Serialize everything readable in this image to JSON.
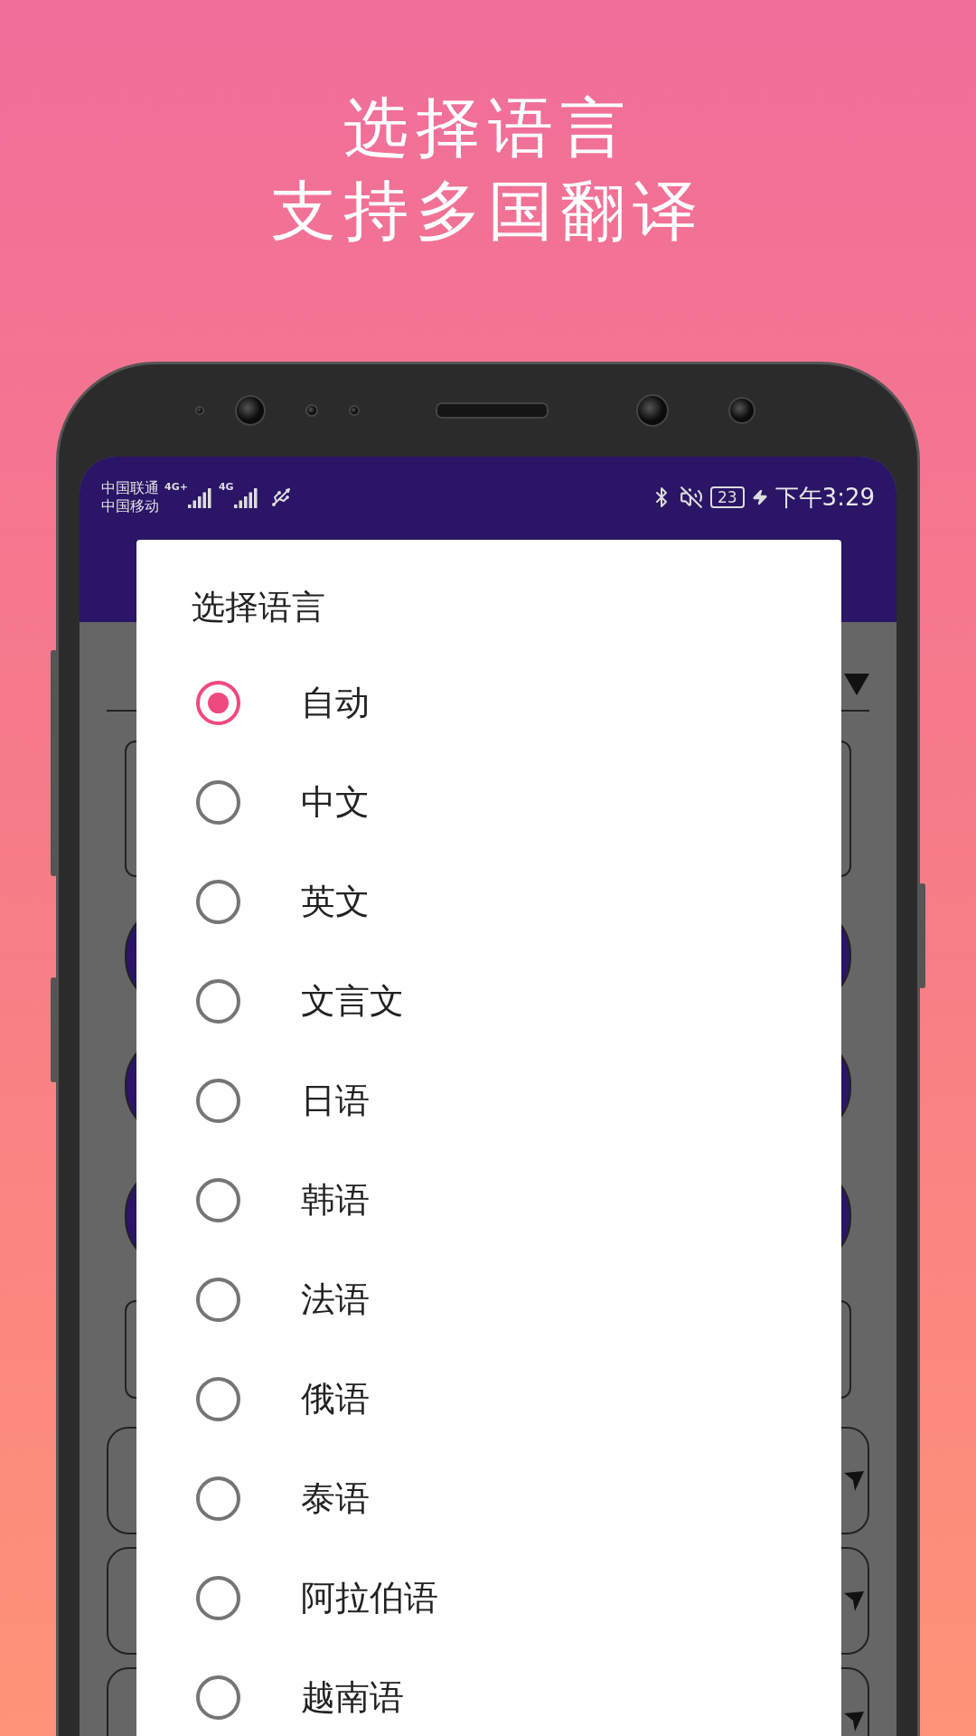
{
  "headline": [
    "选择语言",
    "支持多国翻译"
  ],
  "status_bar": {
    "carriers": [
      "中国联通",
      "中国移动"
    ],
    "network_labels": [
      "4G+",
      "4G"
    ],
    "battery": "23",
    "time": "下午3:29"
  },
  "dialog": {
    "title": "选择语言",
    "options": [
      {
        "label": "自动",
        "selected": true
      },
      {
        "label": "中文",
        "selected": false
      },
      {
        "label": "英文",
        "selected": false
      },
      {
        "label": "文言文",
        "selected": false
      },
      {
        "label": "日语",
        "selected": false
      },
      {
        "label": "韩语",
        "selected": false
      },
      {
        "label": "法语",
        "selected": false
      },
      {
        "label": "俄语",
        "selected": false
      },
      {
        "label": "泰语",
        "selected": false
      },
      {
        "label": "阿拉伯语",
        "selected": false
      },
      {
        "label": "越南语",
        "selected": false
      }
    ]
  }
}
